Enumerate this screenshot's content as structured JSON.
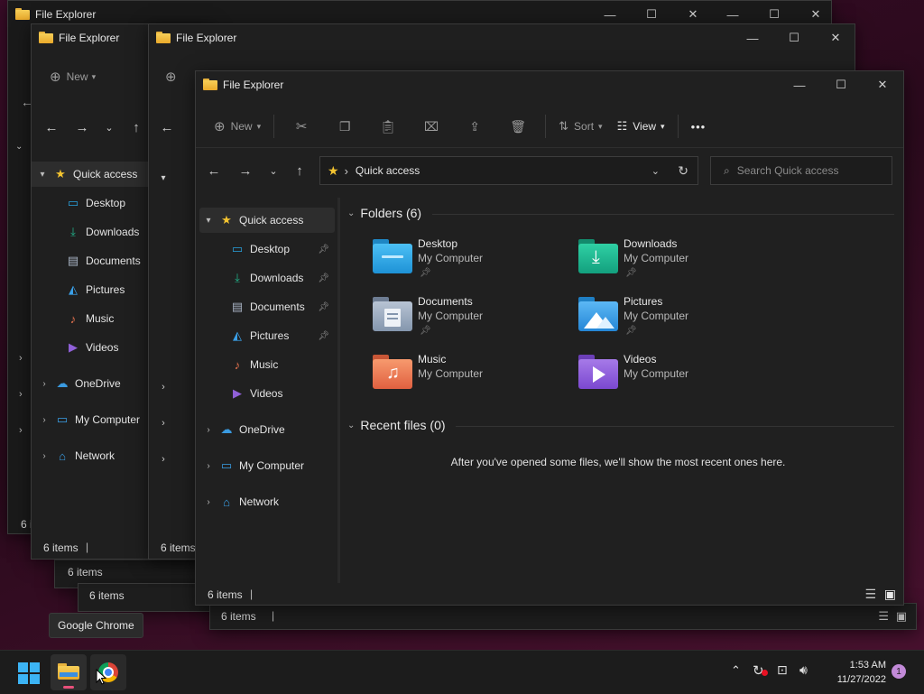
{
  "app_title": "File Explorer",
  "background_windows": [
    {
      "status": "6 items"
    },
    {
      "status": "6 items"
    },
    {
      "status": "6 items"
    },
    {
      "status": "6 items"
    }
  ],
  "toolbar": {
    "new_label": "New",
    "sort_label": "Sort",
    "view_label": "View",
    "more_label": "•••"
  },
  "address": {
    "path": "Quick access",
    "search_placeholder": "Search Quick access"
  },
  "nav_pane": {
    "quick_access": "Quick access",
    "pinned": [
      {
        "label": "Desktop"
      },
      {
        "label": "Downloads"
      },
      {
        "label": "Documents"
      },
      {
        "label": "Pictures"
      }
    ],
    "others": [
      {
        "label": "Music"
      },
      {
        "label": "Videos"
      }
    ],
    "onedrive": "OneDrive",
    "my_computer": "My Computer",
    "network": "Network"
  },
  "folders_header": "Folders (6)",
  "folders": [
    {
      "name": "Desktop",
      "location": "My Computer",
      "color": "#2aa5e6"
    },
    {
      "name": "Downloads",
      "location": "My Computer",
      "color": "#1fb58f"
    },
    {
      "name": "Documents",
      "location": "My Computer",
      "color": "#8fa0b8"
    },
    {
      "name": "Pictures",
      "location": "My Computer",
      "color": "#3aa0e8"
    },
    {
      "name": "Music",
      "location": "My Computer",
      "color": "#e9744f"
    },
    {
      "name": "Videos",
      "location": "My Computer",
      "color": "#9060d8"
    }
  ],
  "recent_header": "Recent files (0)",
  "recent_empty": "After you've opened some files, we'll show the most recent ones here.",
  "status": {
    "items": "6 items"
  },
  "tooltip": "Google Chrome",
  "tray": {
    "time": "1:53 AM",
    "date": "11/27/2022",
    "notifications": "1"
  }
}
